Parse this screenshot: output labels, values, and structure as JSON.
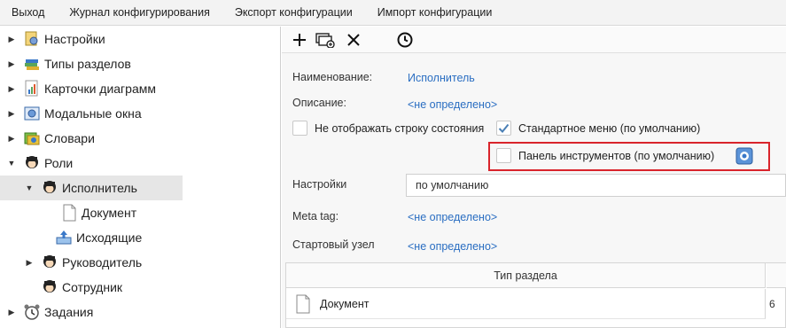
{
  "menu": [
    "Выход",
    "Журнал конфигурирования",
    "Экспорт конфигурации",
    "Импорт конфигурации"
  ],
  "tree": {
    "settings": "Настройки",
    "section_types": "Типы разделов",
    "chart_cards": "Карточки диаграмм",
    "modal_windows": "Модальные окна",
    "dictionaries": "Словари",
    "roles": "Роли",
    "executor": "Исполнитель",
    "document": "Документ",
    "outgoing": "Исходящие",
    "manager": "Руководитель",
    "employee": "Сотрудник",
    "tasks": "Задания"
  },
  "form": {
    "name_label": "Наименование:",
    "name_value": "Исполнитель",
    "description_label": "Описание:",
    "description_value": "<не определено>",
    "hide_status_label": "Не отображать строку состояния",
    "standard_menu_label": "Стандартное меню (по умолчанию)",
    "toolbar_panel_label": "Панель инструментов (по умолчанию)",
    "settings_label": "Настройки",
    "settings_value": "по умолчанию",
    "meta_label": "Meta tag:",
    "meta_value": "<не определено>",
    "start_node_label": "Стартовый узел",
    "start_node_value": "<не определено>"
  },
  "table": {
    "header": "Тип раздела",
    "rows": [
      {
        "name": "Документ",
        "side": "6"
      }
    ]
  },
  "colors": {
    "link": "#2a6ec2",
    "highlight": "#d9242b",
    "selected_row": "#e6e6e6"
  }
}
